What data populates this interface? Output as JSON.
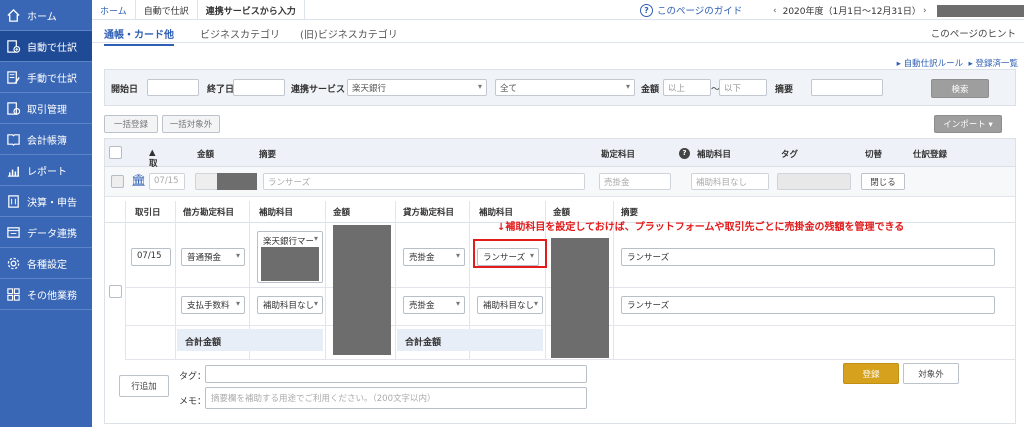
{
  "sidebar": {
    "items": [
      {
        "label": "ホーム",
        "icon": "home-icon"
      },
      {
        "label": "自動で仕訳",
        "icon": "auto-journal-icon",
        "active": true
      },
      {
        "label": "手動で仕訳",
        "icon": "manual-journal-icon"
      },
      {
        "label": "取引管理",
        "icon": "transaction-icon"
      },
      {
        "label": "会計帳簿",
        "icon": "ledger-icon"
      },
      {
        "label": "レポート",
        "icon": "report-chart-icon"
      },
      {
        "label": "決算・申告",
        "icon": "tax-doc-icon"
      },
      {
        "label": "データ連携",
        "icon": "data-link-icon"
      },
      {
        "label": "各種設定",
        "icon": "gear-icon"
      },
      {
        "label": "その他業務",
        "icon": "other-apps-icon"
      }
    ]
  },
  "breadcrumb": {
    "home": "ホーム",
    "auto": "自動で仕訳",
    "current": "連携サービスから入力"
  },
  "header": {
    "guide": "このページのガイド",
    "fiscal_year": "2020年度（1月1日〜12月31日）",
    "hint": "このページのヒント"
  },
  "tabs": [
    "通帳・カード他",
    "ビジネスカテゴリ",
    "(旧)ビジネスカテゴリ"
  ],
  "links": {
    "rules": "▸ 自動仕訳ルール",
    "registered": "▸ 登録済一覧"
  },
  "filter": {
    "start_label": "開始日",
    "end_label": "終了日",
    "service_label": "連携サービス",
    "service_value": "楽天銀行",
    "all_value": "全て",
    "amount_label": "金額",
    "amount_min": "以上",
    "tilde": "〜",
    "amount_max": "以下",
    "memo_label": "摘要",
    "search": "検索"
  },
  "actions": {
    "bulk_register": "一括登録",
    "bulk_exclude": "一括対象外",
    "import": "インポート ▾"
  },
  "table": {
    "headers": {
      "date": "取引日",
      "amount": "金額",
      "memo": "摘要",
      "account": "勘定科目",
      "sub": "補助科目",
      "tag": "タグ",
      "toggle": "切替",
      "register": "仕訳登録"
    },
    "row": {
      "date": "07/15",
      "memo": "ランサーズ",
      "account": "売掛金",
      "sub": "補助科目なし",
      "close": "閉じる"
    }
  },
  "detail": {
    "headers": {
      "date": "取引日",
      "debit": "借方勘定科目",
      "debit_sub": "補助科目",
      "debit_amount": "金額",
      "credit": "貸方勘定科目",
      "credit_sub": "補助科目",
      "credit_amount": "金額",
      "memo": "摘要"
    },
    "line1": {
      "date": "07/15",
      "debit": "普通預金",
      "debit_sub": "楽天銀行マー",
      "credit": "売掛金",
      "credit_sub": "ランサーズ",
      "memo": "ランサーズ"
    },
    "line2": {
      "debit": "支払手数料",
      "debit_sub": "補助科目なし",
      "credit": "売掛金",
      "credit_sub": "補助科目なし",
      "memo": "ランサーズ"
    },
    "total_debit": "合計金額",
    "total_credit": "合計金額",
    "add_row": "行追加",
    "tag_label": "タグ：",
    "memo_label": "メモ：",
    "memo_placeholder": "摘要欄を補助する用途でご利用ください。（200文字以内）",
    "register": "登録",
    "exclude": "対象外"
  },
  "annotation": "↓補助科目を設定しておけば、プラットフォームや取引先ごとに売掛金の残額を管理できる",
  "colors": {
    "sidebar": "#3a67b5",
    "accent": "#2e5fb4",
    "annotation": "#e21b1b",
    "register_button": "#d6a21e"
  }
}
